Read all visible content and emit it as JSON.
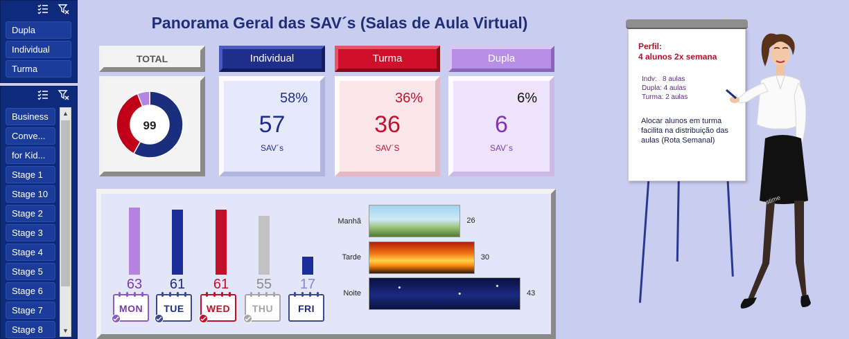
{
  "slicer_top": {
    "items": [
      "Dupla",
      "Individual",
      "Turma"
    ]
  },
  "slicer_bottom": {
    "items": [
      "Business",
      "Conve...",
      "for Kid...",
      "Stage 1",
      "Stage 10",
      "Stage 2",
      "Stage 3",
      "Stage 4",
      "Stage 5",
      "Stage 6",
      "Stage 7",
      "Stage 8"
    ]
  },
  "title": "Panorama Geral das SAV´s (Salas de Aula Virtual)",
  "total": {
    "label": "TOTAL",
    "value": "99",
    "donut": [
      {
        "name": "Individual",
        "share": 0.58,
        "color": "#1b2d7d"
      },
      {
        "name": "Turma",
        "share": 0.36,
        "color": "#c00018"
      },
      {
        "name": "Dupla",
        "share": 0.06,
        "color": "#b185e0"
      }
    ]
  },
  "kpis": [
    {
      "label": "Individual",
      "pct": "58%",
      "value": "57",
      "unit": "SAV´s",
      "color": "#1f2e8a"
    },
    {
      "label": "Turma",
      "pct": "36%",
      "value": "36",
      "unit": "SAV´S",
      "color": "#c0142c"
    },
    {
      "label": "Dupla",
      "pct": "6%",
      "value": "6",
      "unit": "SAV´s",
      "color": "#7b3aa8"
    }
  ],
  "days": [
    {
      "label": "MON",
      "value": 63,
      "display": "63",
      "color": "#b483e0",
      "text_color": "#7b3aa8"
    },
    {
      "label": "TUE",
      "value": 61,
      "display": "61",
      "color": "#1b2d9a",
      "text_color": "#1b2d7d"
    },
    {
      "label": "WED",
      "value": 61,
      "display": "61",
      "color": "#c0102a",
      "text_color": "#c0102a"
    },
    {
      "label": "THU",
      "value": 55,
      "display": "55",
      "color": "#c2c2c2",
      "text_color": "#8a8a8a"
    },
    {
      "label": "FRI",
      "value": 17,
      "display": "17",
      "color": "#1b2d9a",
      "text_color": "#8b84d8"
    }
  ],
  "periods": [
    {
      "label": "Manhã",
      "value": 26,
      "display": "26",
      "scene": "morning"
    },
    {
      "label": "Tarde",
      "value": 30,
      "display": "30",
      "scene": "sunset"
    },
    {
      "label": "Noite",
      "value": 43,
      "display": "43",
      "scene": "night"
    }
  ],
  "flipchart": {
    "perfil": "Perfil:",
    "perfil_value": "4 alunos 2x semana",
    "aulas": [
      "Indv:   8 aulas",
      "Dupla: 4 aulas",
      "Turma: 2 aulas"
    ],
    "note": "Alocar alunos em turma facilita na distribuição das aulas (Rota Semanal)"
  },
  "watermark": "dreamstime"
}
